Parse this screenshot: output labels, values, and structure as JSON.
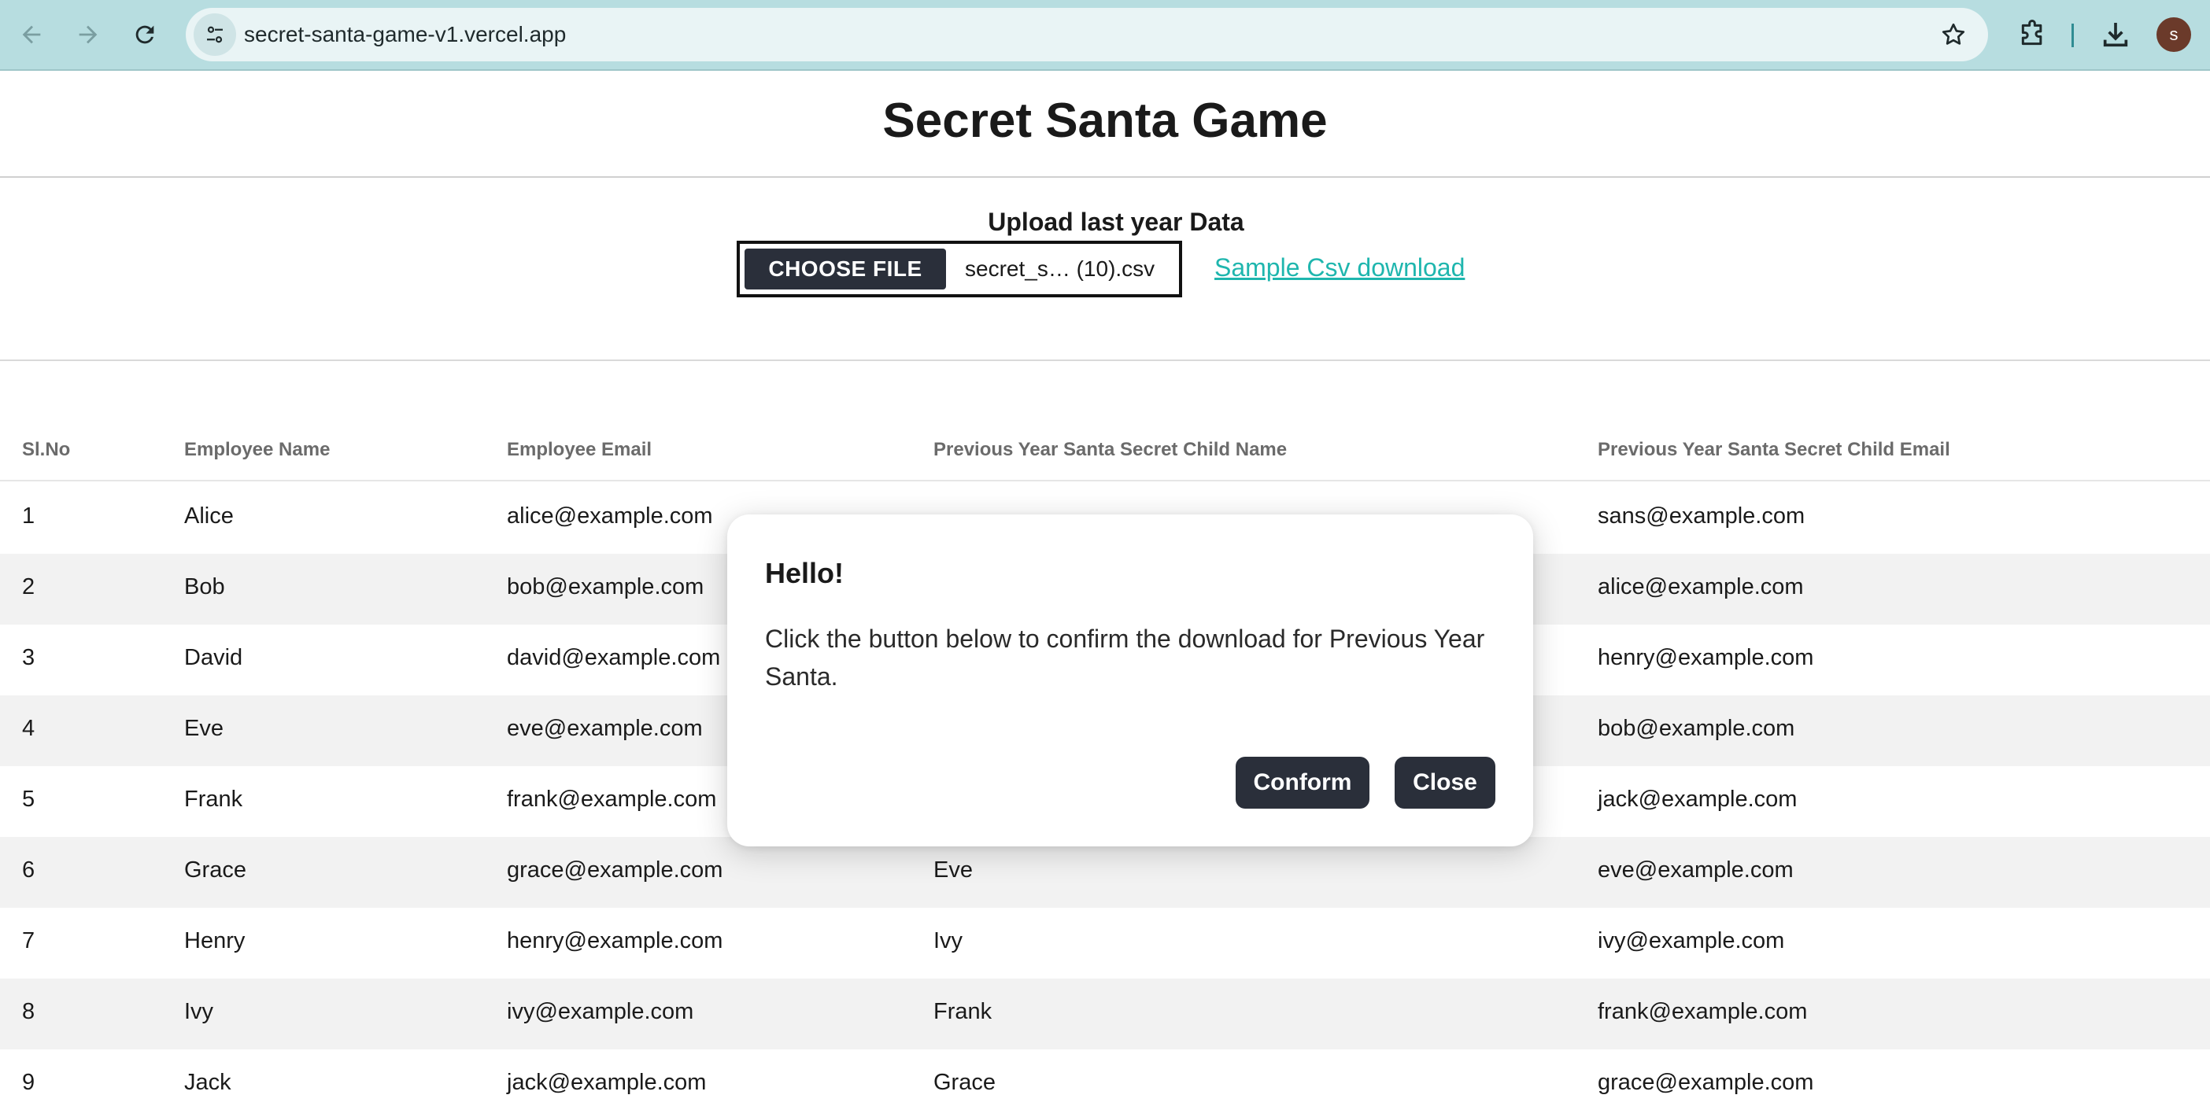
{
  "browser": {
    "url": "secret-santa-game-v1.vercel.app",
    "profile_initial": "s"
  },
  "page": {
    "title": "Secret Santa Game",
    "upload_label": "Upload last year Data",
    "choose_file_label": "CHOOSE FILE",
    "file_name": "secret_s… (10).csv",
    "sample_link": "Sample Csv download"
  },
  "table": {
    "headers": [
      "Sl.No",
      "Employee Name",
      "Employee Email",
      "Previous Year Santa Secret Child Name",
      "Previous Year Santa Secret Child Email"
    ],
    "rows": [
      [
        "1",
        "Alice",
        "alice@example.com",
        "",
        "sans@example.com"
      ],
      [
        "2",
        "Bob",
        "bob@example.com",
        "",
        "alice@example.com"
      ],
      [
        "3",
        "David",
        "david@example.com",
        "",
        "henry@example.com"
      ],
      [
        "4",
        "Eve",
        "eve@example.com",
        "",
        "bob@example.com"
      ],
      [
        "5",
        "Frank",
        "frank@example.com",
        "",
        "jack@example.com"
      ],
      [
        "6",
        "Grace",
        "grace@example.com",
        "Eve",
        "eve@example.com"
      ],
      [
        "7",
        "Henry",
        "henry@example.com",
        "Ivy",
        "ivy@example.com"
      ],
      [
        "8",
        "Ivy",
        "ivy@example.com",
        "Frank",
        "frank@example.com"
      ],
      [
        "9",
        "Jack",
        "jack@example.com",
        "Grace",
        "grace@example.com"
      ]
    ]
  },
  "modal": {
    "title": "Hello!",
    "body": "Click the button below to confirm the download for Previous Year Santa.",
    "confirm_label": "Conform",
    "close_label": "Close"
  },
  "colors": {
    "browser_bar": "#b7dde0",
    "button_dark": "#2a2f3a",
    "link": "#1fb6ae",
    "row_alt": "#f2f2f2"
  }
}
